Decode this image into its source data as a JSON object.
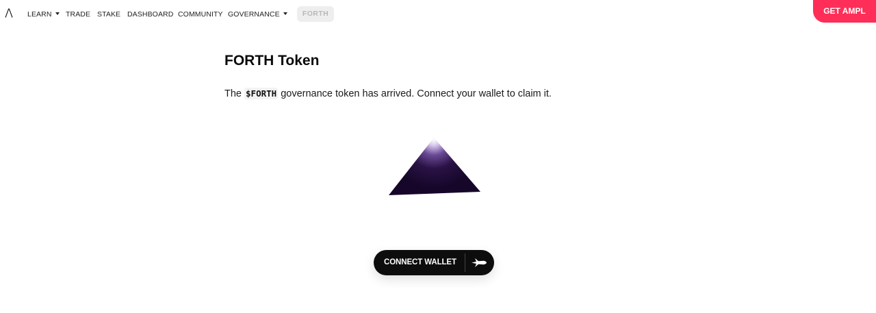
{
  "nav": {
    "logo_icon": "lambda-logo-icon",
    "items": [
      {
        "label": "LEARN",
        "has_dropdown": true
      },
      {
        "label": "TRADE",
        "has_dropdown": false
      },
      {
        "label": "STAKE",
        "has_dropdown": false
      },
      {
        "label": "DASHBOARD",
        "has_dropdown": false
      },
      {
        "label": "COMMUNITY",
        "has_dropdown": false
      },
      {
        "label": "GOVERNANCE",
        "has_dropdown": true
      }
    ],
    "forth_label": "FORTH",
    "get_ampl_label": "GET AMPL"
  },
  "main": {
    "title": "FORTH Token",
    "intro_prefix": "The ",
    "token_code": "$FORTH",
    "intro_suffix": " governance token has arrived. Connect your wallet to claim it.",
    "illustration_icon": "pyramid-illustration",
    "connect_label": "CONNECT WALLET",
    "connect_icon": "rocket-icon"
  },
  "colors": {
    "accent": "#ff2e58",
    "button_dark": "#0d0d0d",
    "pyramid_dark": "#1b0a2e",
    "pyramid_highlight": "#5a3a8a"
  }
}
